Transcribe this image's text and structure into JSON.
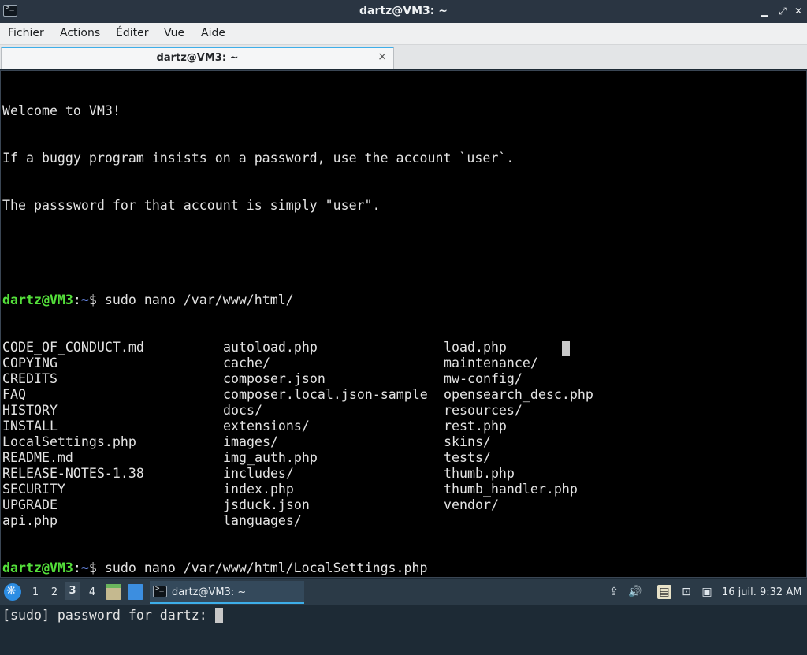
{
  "window": {
    "title": "dartz@VM3: ~"
  },
  "menu": [
    "Fichier",
    "Actions",
    "Éditer",
    "Vue",
    "Aide"
  ],
  "tab": {
    "label": "dartz@VM3: ~",
    "close_glyph": "×"
  },
  "terminal": {
    "motd": [
      "Welcome to VM3!",
      "If a buggy program insists on a password, use the account `user`.",
      "The passsword for that account is simply \"user\"."
    ],
    "prompt_user": "dartz@VM3",
    "prompt_sep": ":",
    "prompt_path": "~",
    "prompt_end": "$ ",
    "command1": "sudo nano /var/www/html/",
    "listing": [
      [
        "CODE_OF_CONDUCT.md",
        "autoload.php",
        "load.php"
      ],
      [
        "COPYING",
        "cache/",
        "maintenance/"
      ],
      [
        "CREDITS",
        "composer.json",
        "mw-config/"
      ],
      [
        "FAQ",
        "composer.local.json-sample",
        "opensearch_desc.php"
      ],
      [
        "HISTORY",
        "docs/",
        "resources/"
      ],
      [
        "INSTALL",
        "extensions/",
        "rest.php"
      ],
      [
        "LocalSettings.php",
        "images/",
        "skins/"
      ],
      [
        "README.md",
        "img_auth.php",
        "tests/"
      ],
      [
        "RELEASE-NOTES-1.38",
        "includes/",
        "thumb.php"
      ],
      [
        "SECURITY",
        "index.php",
        "thumb_handler.php"
      ],
      [
        "UPGRADE",
        "jsduck.json",
        "vendor/"
      ],
      [
        "api.php",
        "languages/",
        ""
      ]
    ],
    "command2": "sudo nano /var/www/html/LocalSettings.php",
    "sudo_prompt": "[sudo] password for dartz: "
  },
  "taskbar": {
    "workspaces": [
      "1",
      "2",
      "3",
      "4"
    ],
    "active_workspace": "3",
    "task_label": "dartz@VM3: ~",
    "clock": "16 juil. 9:32 AM",
    "icons": [
      "start-menu-icon",
      "file-manager-icon",
      "show-desktop-icon",
      "terminal-icon",
      "upload-icon",
      "volume-icon",
      "clipboard-icon",
      "network-icon",
      "notification-icon"
    ]
  }
}
